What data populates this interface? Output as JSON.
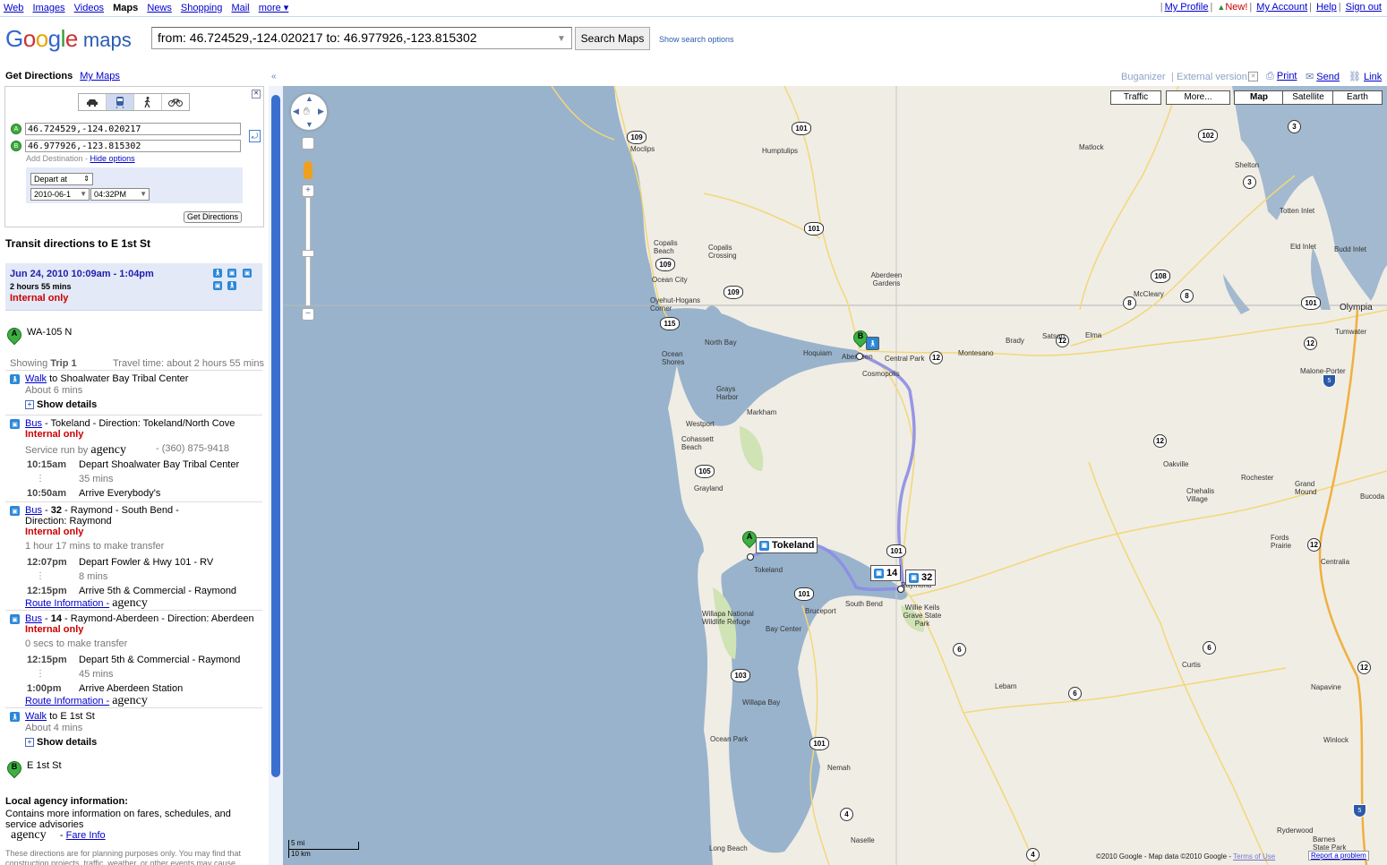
{
  "topnav": {
    "items": [
      "Web",
      "Images",
      "Videos",
      "Maps",
      "News",
      "Shopping",
      "Mail",
      "more ▾"
    ],
    "current": "Maps"
  },
  "account": {
    "profile": "My Profile",
    "new": "New!",
    "account": "My Account",
    "help": "Help",
    "signout": "Sign out"
  },
  "logo": {
    "google": "Google",
    "maps": "maps"
  },
  "search": {
    "value": "from: 46.724529,-124.020217 to: 46.977926,-123.815302",
    "button": "Search Maps",
    "options": "Show search options"
  },
  "left": {
    "get_directions": "Get Directions",
    "my_maps": "My Maps",
    "modes": [
      "car",
      "transit",
      "walk",
      "bike"
    ],
    "from": "46.724529,-124.020217",
    "to": "46.977926,-123.815302",
    "add_destination": "Add Destination",
    "hide_options": "Hide options",
    "depart": "Depart at",
    "date": "2010-06-1",
    "time": "04:32PM",
    "get_dir_btn": "Get Directions",
    "transit_heading": "Transit directions to E 1st St",
    "summary": {
      "time": "Jun 24, 2010 10:09am - 1:04pm",
      "duration": "2 hours 55 mins",
      "internal": "Internal only"
    },
    "start": "WA-105 N",
    "showing": "Showing",
    "trip": "Trip 1",
    "travel_time": "Travel time: about 2 hours 55 mins",
    "step1": {
      "walk": "Walk",
      "to": " to Shoalwater Bay Tribal Center",
      "about": "About 6 mins",
      "details": "Show details"
    },
    "step2": {
      "bus": "Bus",
      "title": " - Tokeland - Direction: Tokeland/North Cove",
      "internal": "Internal only",
      "service": "Service run by",
      "agency": "agency",
      "phone": "- (360) 875-9418",
      "t1": "10:15am",
      "d1": "Depart Shoalwater Bay Tribal Center",
      "mins": "35 mins",
      "t2": "10:50am",
      "d2": "Arrive Everybody's"
    },
    "step3": {
      "bus": "Bus",
      "title_a": " - ",
      "num": "32",
      "title_b": " - Raymond - South Bend -",
      "title_c": "Direction: Raymond",
      "internal": "Internal only",
      "transfer": "1 hour 17 mins to make transfer",
      "t1": "12:07pm",
      "d1": "Depart Fowler & Hwy 101 - RV",
      "mins": "8 mins",
      "t2": "12:15pm",
      "d2": "Arrive 5th & Commercial - Raymond",
      "route": "Route Information -",
      "agency": "agency"
    },
    "step4": {
      "bus": "Bus",
      "title_a": " - ",
      "num": "14",
      "title_b": " - Raymond-Aberdeen - Direction: Aberdeen",
      "internal": "Internal only",
      "transfer": "0 secs to make transfer",
      "t1": "12:15pm",
      "d1": "Depart 5th & Commercial - Raymond",
      "mins": "45 mins",
      "t2": "1:00pm",
      "d2": "Arrive Aberdeen Station",
      "route": "Route Information -",
      "agency": "agency"
    },
    "step5": {
      "walk": "Walk",
      "to": " to E 1st St",
      "about": "About 4 mins",
      "details": "Show details"
    },
    "end": "E 1st St",
    "local_head": "Local agency information:",
    "local_text": "Contains more information on fares, schedules, and service advisories",
    "local_agency": "agency",
    "fare": "Fare Info",
    "disclaimer": "These directions are for planning purposes only. You may find that construction projects, traffic, weather, or other events may cause"
  },
  "mapbar": {
    "buganizer": "Buganizer",
    "external": "External version",
    "print": "Print",
    "send": "Send",
    "link": "Link"
  },
  "map": {
    "buttons": [
      "Traffic",
      "More...",
      "Map",
      "Satellite",
      "Earth"
    ],
    "selected": "Map",
    "labels": [
      "Moclips",
      "Humptulips",
      "Matlock",
      "Shelton",
      "Totten Inlet",
      "Eld Inlet",
      "Budd Inlet",
      "Copalis Beach",
      "Copalis Crossing",
      "Ocean City",
      "Oyehut-Hogans Corner",
      "Aberdeen Gardens",
      "McCleary",
      "Olympia",
      "Tumwater",
      "Brady",
      "Satsop",
      "Elma",
      "Montesano",
      "Hoquiam",
      "Central Park",
      "Cosmopolis",
      "Malone-Porter",
      "Westport",
      "Cohassett Beach",
      "Markham",
      "Oakville",
      "Rochester",
      "Grand Mound",
      "Grayland",
      "Chehalis Village",
      "Bucoda",
      "Fords Prairie",
      "Centralia",
      "Tokeland",
      "South Bend",
      "Raymond",
      "Bruceport",
      "Willie Keils Grave State Park",
      "Bay Center",
      "Napavine",
      "Curtis",
      "Lebam",
      "Winlock",
      "Ocean Park",
      "Nemah",
      "Naselle",
      "Long Beach",
      "Ryderwood",
      "Barnes State Park",
      "Aberdeen"
    ],
    "water_labels": [
      "North Bay",
      "Ocean Shores",
      "Grays Harbor",
      "Willapa National Wildlife Refuge",
      "Willapa Bay"
    ],
    "markers": {
      "a": "A",
      "b": "B",
      "tokeland": "Tokeland",
      "bus14": "14",
      "bus32": "32"
    },
    "scale": {
      "mi": "5 mi",
      "km": "10 km"
    },
    "copyright": "©2010 Google - Map data ©2010 Google -",
    "terms": "Terms of Use",
    "report": "Report a problem"
  },
  "colors": {
    "water": "#99b3cc",
    "land": "#f0ede5",
    "route": "#8c8ce6",
    "hwy": "#f7e79b",
    "pin": "#3cb043",
    "transit_icon": "#2a87d8",
    "internal": "#cc0000"
  }
}
